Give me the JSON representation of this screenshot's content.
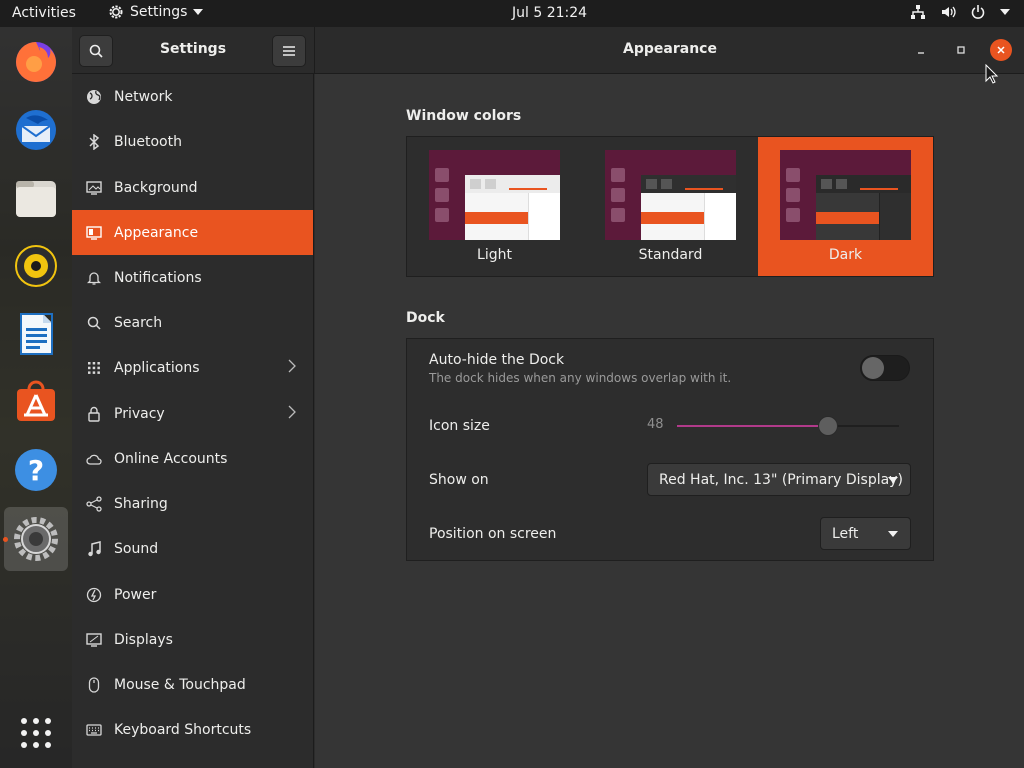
{
  "topbar": {
    "activities": "Activities",
    "app_menu": "Settings",
    "clock": "Jul 5  21:24"
  },
  "sidebar_header": {
    "title": "Settings"
  },
  "content_header": {
    "title": "Appearance"
  },
  "sidebar": {
    "items": [
      {
        "label": "Network",
        "icon": "globe-icon"
      },
      {
        "label": "Bluetooth",
        "icon": "bluetooth-icon"
      },
      {
        "label": "Background",
        "icon": "monitor-icon"
      },
      {
        "label": "Appearance",
        "icon": "appearance-icon",
        "active": true
      },
      {
        "label": "Notifications",
        "icon": "bell-icon"
      },
      {
        "label": "Search",
        "icon": "search-icon"
      },
      {
        "label": "Applications",
        "icon": "grid-icon",
        "chevron": true
      },
      {
        "label": "Privacy",
        "icon": "lock-icon",
        "chevron": true
      },
      {
        "label": "Online Accounts",
        "icon": "cloud-icon"
      },
      {
        "label": "Sharing",
        "icon": "share-icon"
      },
      {
        "label": "Sound",
        "icon": "music-note-icon"
      },
      {
        "label": "Power",
        "icon": "power-icon"
      },
      {
        "label": "Displays",
        "icon": "display-icon"
      },
      {
        "label": "Mouse & Touchpad",
        "icon": "mouse-icon"
      },
      {
        "label": "Keyboard Shortcuts",
        "icon": "keyboard-icon"
      }
    ]
  },
  "window_colors": {
    "title": "Window colors",
    "options": [
      {
        "label": "Light"
      },
      {
        "label": "Standard"
      },
      {
        "label": "Dark",
        "selected": true
      }
    ]
  },
  "dock": {
    "title": "Dock",
    "autohide_label": "Auto-hide the Dock",
    "autohide_desc": "The dock hides when any windows overlap with it.",
    "autohide_on": false,
    "icon_size_label": "Icon size",
    "icon_size_value": "48",
    "icon_size_fraction": 0.68,
    "show_on_label": "Show on",
    "show_on_value": "Red Hat, Inc. 13\" (Primary Display)",
    "position_label": "Position on screen",
    "position_value": "Left"
  },
  "colors": {
    "accent": "#e95420",
    "slider": "#b13a8a"
  }
}
